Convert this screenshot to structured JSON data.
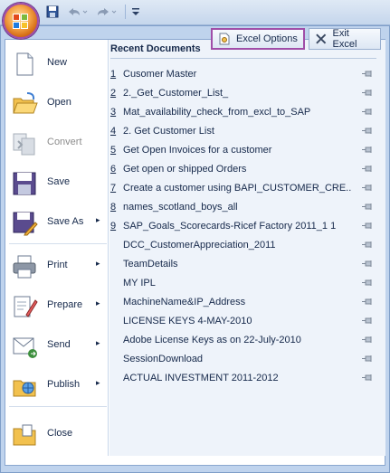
{
  "menu": {
    "commands": [
      {
        "id": "new",
        "label": "New",
        "has_submenu": false,
        "enabled": true
      },
      {
        "id": "open",
        "label": "Open",
        "has_submenu": false,
        "enabled": true
      },
      {
        "id": "convert",
        "label": "Convert",
        "has_submenu": false,
        "enabled": false
      },
      {
        "id": "save",
        "label": "Save",
        "has_submenu": false,
        "enabled": true
      },
      {
        "id": "save-as",
        "label": "Save As",
        "has_submenu": true,
        "enabled": true
      },
      {
        "id": "print",
        "label": "Print",
        "has_submenu": true,
        "enabled": true
      },
      {
        "id": "prepare",
        "label": "Prepare",
        "has_submenu": true,
        "enabled": true
      },
      {
        "id": "send",
        "label": "Send",
        "has_submenu": true,
        "enabled": true
      },
      {
        "id": "publish",
        "label": "Publish",
        "has_submenu": true,
        "enabled": true
      },
      {
        "id": "close",
        "label": "Close",
        "has_submenu": false,
        "enabled": true
      }
    ],
    "submenu_arrow": "▸"
  },
  "recent": {
    "title": "Recent Documents",
    "items": [
      {
        "num": "1",
        "name": "Cusomer Master"
      },
      {
        "num": "2",
        "name": "2._Get_Customer_List_"
      },
      {
        "num": "3",
        "name": "Mat_availability_check_from_excl_to_SAP"
      },
      {
        "num": "4",
        "name": "2. Get Customer List"
      },
      {
        "num": "5",
        "name": "Get Open Invoices for a customer"
      },
      {
        "num": "6",
        "name": "Get open or shipped Orders"
      },
      {
        "num": "7",
        "name": "Create a customer using BAPI_CUSTOMER_CRE..."
      },
      {
        "num": "8",
        "name": "names_scotland_boys_all"
      },
      {
        "num": "9",
        "name": "SAP_Goals_Scorecards-Ricef Factory 2011_1 1"
      },
      {
        "num": "",
        "name": "DCC_CustomerAppreciation_2011"
      },
      {
        "num": "",
        "name": "TeamDetails"
      },
      {
        "num": "",
        "name": "MY IPL"
      },
      {
        "num": "",
        "name": "MachineName&IP_Address"
      },
      {
        "num": "",
        "name": "LICENSE KEYS 4-MAY-2010"
      },
      {
        "num": "",
        "name": "Adobe License Keys as on 22-July-2010"
      },
      {
        "num": "",
        "name": "SessionDownload"
      },
      {
        "num": "",
        "name": "ACTUAL INVESTMENT 2011-2012"
      }
    ]
  },
  "footer": {
    "options_label": "Excel Options",
    "exit_label": "Exit Excel"
  },
  "colors": {
    "highlight": "#a04ea8",
    "text": "#15284a",
    "panel": "#eef3fa"
  }
}
